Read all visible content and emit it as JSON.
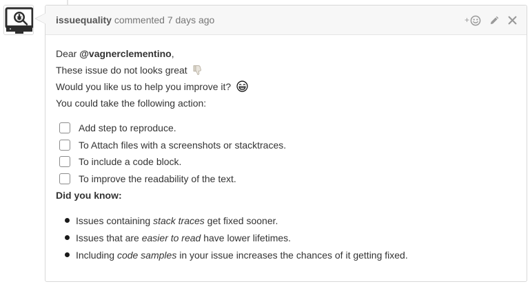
{
  "comment": {
    "author": "issuequality",
    "meta_text": "commented 7 days ago",
    "greeting_prefix": "Dear",
    "mention": "@vagnerclementino",
    "greeting_suffix": ",",
    "line_1": "These issue do not looks great",
    "line_2": "Would you like us to help you improve it?",
    "line_3": "You could take the following action:",
    "tasks": [
      {
        "label": "Add step to reproduce.",
        "checked": false
      },
      {
        "label": "To Attach files with a screenshots or stacktraces.",
        "checked": false
      },
      {
        "label": "To include a code block.",
        "checked": false
      },
      {
        "label": "To improve the readability of the text.",
        "checked": false
      }
    ],
    "did_you_know_heading": "Did you know:",
    "tips": [
      {
        "before": "Issues containing ",
        "em": "stack traces",
        "after": " get fixed sooner."
      },
      {
        "before": "Issues that are ",
        "em": "easier to read",
        "after": " have lower lifetimes."
      },
      {
        "before": "Including ",
        "em": "code samples",
        "after": " in your issue increases the chances of it getting fixed."
      }
    ]
  },
  "header_actions": {
    "reaction_plus": "+",
    "icons": [
      "smiley-reaction-icon",
      "pencil-edit-icon",
      "close-icon"
    ]
  },
  "icons": {
    "avatar": "bug-monitor-avatar",
    "thumbs_down": "thumbs-down-icon",
    "grin": "grinning-face-icon"
  },
  "colors": {
    "border": "#d8d8d8",
    "header_bg": "#f7f7f7",
    "text": "#333333",
    "muted": "#767676",
    "icon_gray": "#999999"
  }
}
